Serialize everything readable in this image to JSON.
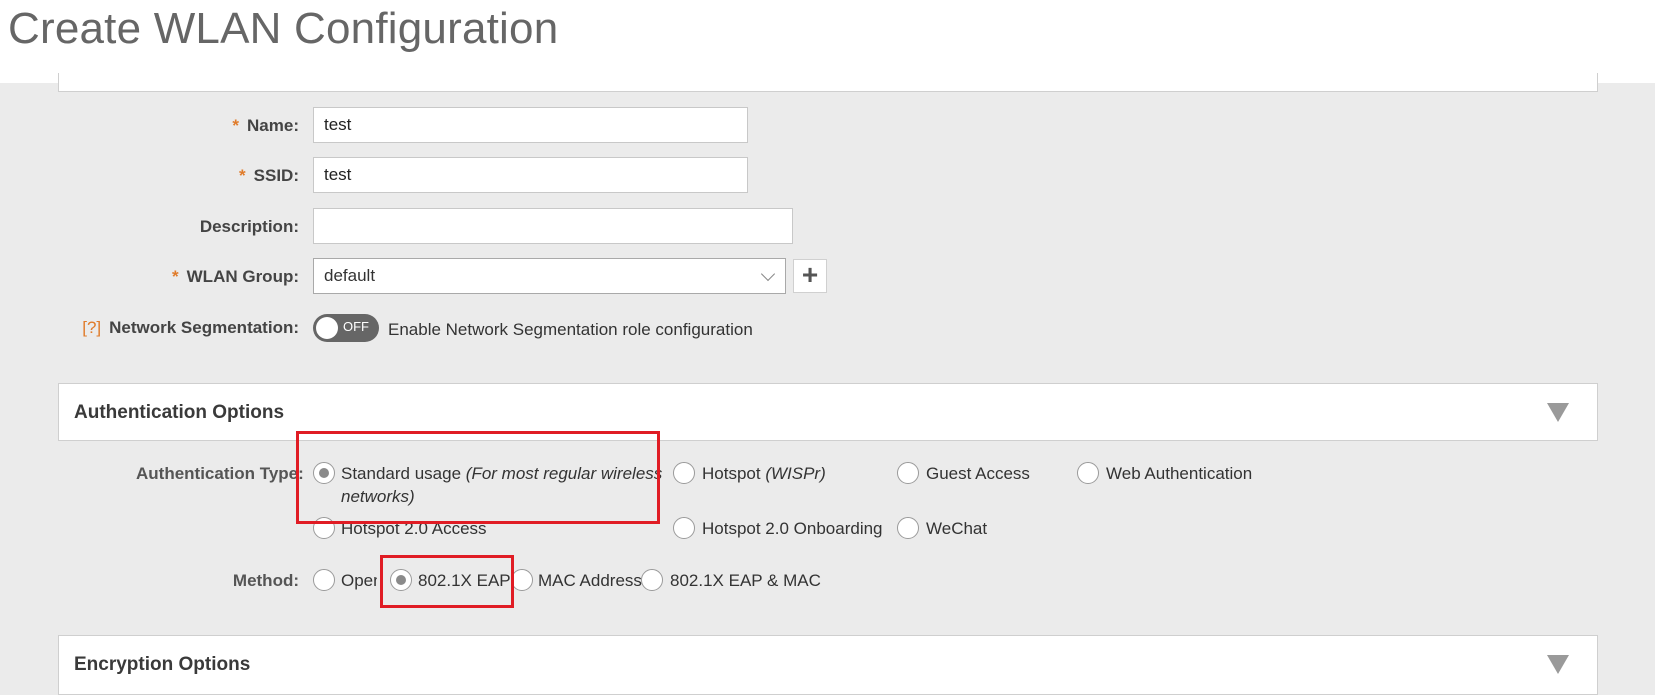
{
  "header": {
    "title": "Create WLAN Configuration"
  },
  "form": {
    "name": {
      "label": "Name:",
      "value": "test"
    },
    "ssid": {
      "label": "SSID:",
      "value": "test"
    },
    "description": {
      "label": "Description:",
      "value": ""
    },
    "wlan_group": {
      "label": "WLAN Group:",
      "value": "default",
      "add_label": "+"
    },
    "network_segmentation": {
      "help": "[?]",
      "label": "Network Segmentation:",
      "toggle_state": "OFF",
      "description": "Enable Network Segmentation role configuration"
    },
    "required_mark": "*"
  },
  "auth_section": {
    "title": "Authentication Options",
    "type_label": "Authentication Type:",
    "types": [
      {
        "label": "Standard usage",
        "note": "(For most regular wireless",
        "note2": "networks)",
        "checked": true
      },
      {
        "label": "Hotspot",
        "note": "(WISPr)",
        "checked": false
      },
      {
        "label": "Guest Access",
        "checked": false
      },
      {
        "label": "Web Authentication",
        "checked": false
      },
      {
        "label": "Hotspot 2.0 Access",
        "checked": false
      },
      {
        "label": "Hotspot 2.0 Onboarding",
        "checked": false
      },
      {
        "label": "WeChat",
        "checked": false
      }
    ],
    "method_label": "Method:",
    "methods": [
      {
        "label": "Open",
        "checked": false
      },
      {
        "label": "802.1X EAP",
        "checked": true
      },
      {
        "label": "MAC Address",
        "checked": false
      },
      {
        "label": "802.1X EAP & MAC",
        "checked": false
      }
    ]
  },
  "encryption_section": {
    "title": "Encryption Options"
  },
  "colors": {
    "highlight": "#e01c24",
    "required": "#e07b2a",
    "background": "#ebebeb"
  }
}
